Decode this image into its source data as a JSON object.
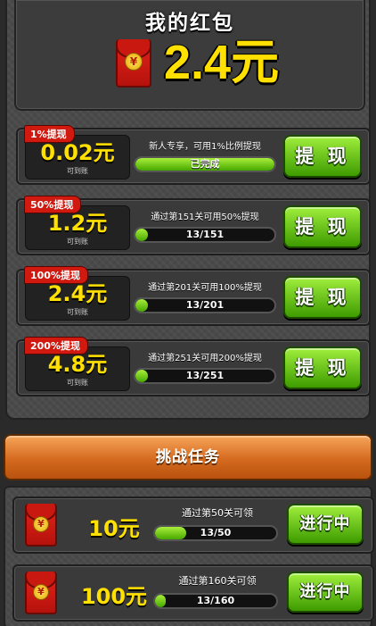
{
  "wallet": {
    "title": "我的红包",
    "envelope_icon": "red-envelope-icon",
    "coin_symbol": "¥",
    "amount": "2.4元"
  },
  "tiers": [
    {
      "badge": "1%提现",
      "amount": "0.02元",
      "sub": "可到账",
      "condition": "新人专享，可用1%比例提现",
      "progress_text": "已完成",
      "progress": 1.0,
      "button": "提 现"
    },
    {
      "badge": "50%提现",
      "amount": "1.2元",
      "sub": "可到账",
      "condition": "通过第151关可用50%提现",
      "progress_text": "13/151",
      "progress": 0.086,
      "button": "提 现"
    },
    {
      "badge": "100%提现",
      "amount": "2.4元",
      "sub": "可到账",
      "condition": "通过第201关可用100%提现",
      "progress_text": "13/201",
      "progress": 0.065,
      "button": "提 现"
    },
    {
      "badge": "200%提现",
      "amount": "4.8元",
      "sub": "可到账",
      "condition": "通过第251关可用200%提现",
      "progress_text": "13/251",
      "progress": 0.052,
      "button": "提 现"
    }
  ],
  "challenge": {
    "title": "挑战任务",
    "tasks": [
      {
        "reward": "10元",
        "condition": "通过第50关可领",
        "progress_text": "13/50",
        "progress": 0.26,
        "button": "进行中"
      },
      {
        "reward": "100元",
        "condition": "通过第160关可领",
        "progress_text": "13/160",
        "progress": 0.081,
        "button": "进行中"
      }
    ]
  },
  "colors": {
    "gold_text": "#ffe000",
    "green_button": "#47a800",
    "red_badge": "#d01a10",
    "orange_header": "#d56a1f"
  }
}
